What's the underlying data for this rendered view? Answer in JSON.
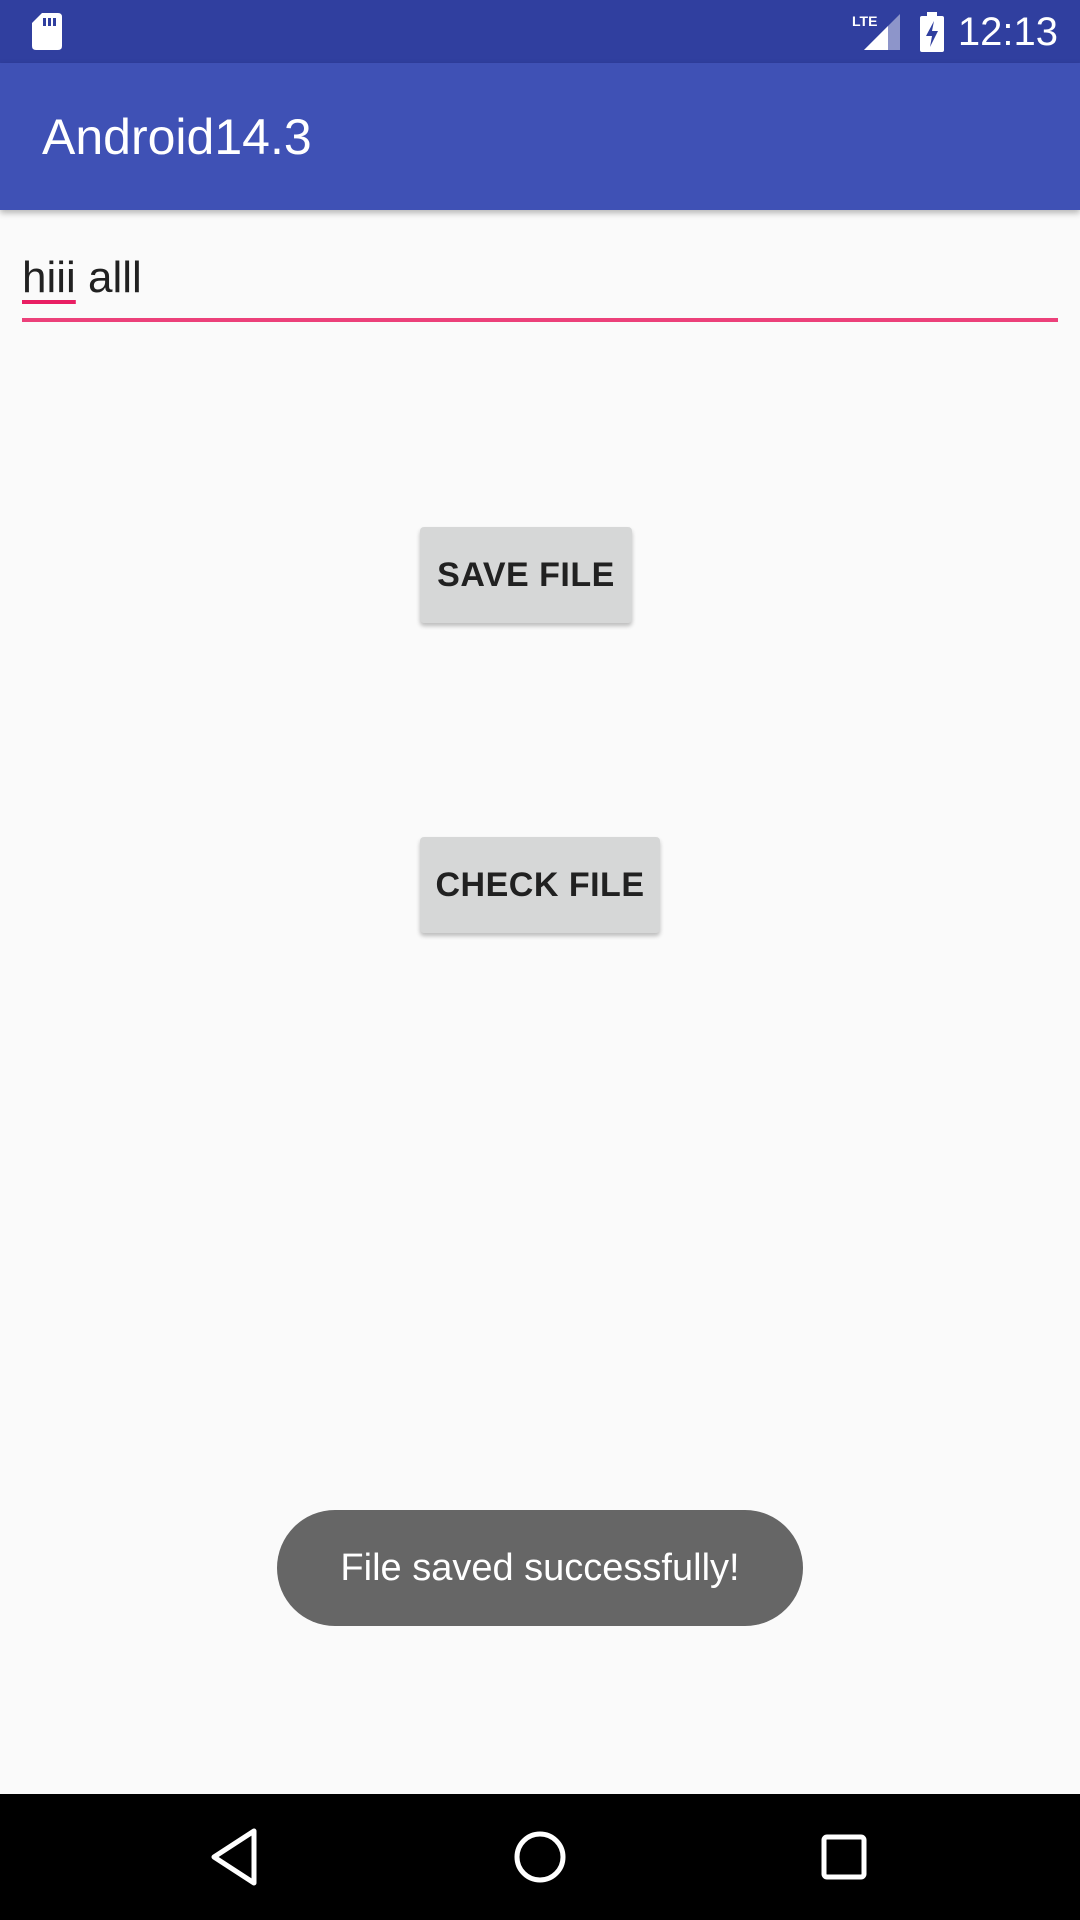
{
  "status_bar": {
    "time": "12:13",
    "network_label": "LTE",
    "icons": [
      "sd-card-icon",
      "lte-signal-icon",
      "battery-charging-icon"
    ]
  },
  "app_bar": {
    "title": "Android14.3"
  },
  "text_field": {
    "value_word1": "hiii",
    "value_rest": " alll"
  },
  "buttons": {
    "save_label": "SAVE FILE",
    "check_label": "CHECK FILE"
  },
  "toast": {
    "message": "File saved successfully!"
  },
  "nav_bar": {
    "icons": [
      "back-icon",
      "home-icon",
      "recents-icon"
    ]
  },
  "colors": {
    "status_bar": "#303f9f",
    "app_bar": "#3f51b5",
    "accent": "#e91e63",
    "button": "#d6d7d7",
    "toast": "#666666",
    "background": "#fafafa"
  }
}
